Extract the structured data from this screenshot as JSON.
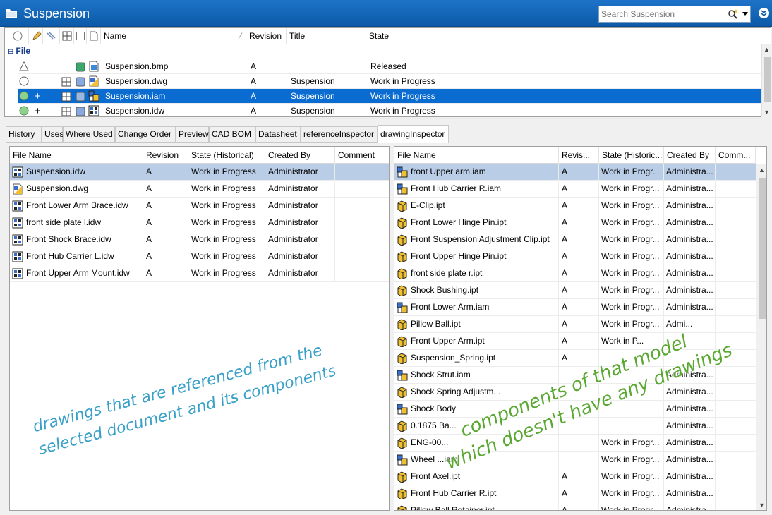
{
  "window": {
    "title": "Suspension",
    "search_placeholder": "Search Suspension"
  },
  "file_list": {
    "columns": [
      "Name",
      "Revision",
      "Title",
      "State"
    ],
    "group_label": "File",
    "rows": [
      {
        "name": "Suspension.bmp",
        "revision": "A",
        "title": "",
        "state": "Released",
        "selected": false,
        "status": "triangle",
        "type": "bmp"
      },
      {
        "name": "Suspension.dwg",
        "revision": "A",
        "title": "Suspension",
        "state": "Work in Progress",
        "selected": false,
        "status": "circle",
        "type": "dwg"
      },
      {
        "name": "Suspension.iam",
        "revision": "A",
        "title": "Suspension",
        "state": "Work in Progress",
        "selected": true,
        "status": "green",
        "type": "iam"
      },
      {
        "name": "Suspension.idw",
        "revision": "A",
        "title": "Suspension",
        "state": "Work in Progress",
        "selected": false,
        "status": "green",
        "type": "idw"
      }
    ]
  },
  "tabs": [
    "History",
    "Uses",
    "Where Used",
    "Change Order",
    "Preview",
    "CAD BOM",
    "Datasheet",
    "referenceInspector",
    "drawingInspector"
  ],
  "active_tab": "drawingInspector",
  "left_panel": {
    "columns": [
      "File Name",
      "Revision",
      "State (Historical)",
      "Created By",
      "Comment"
    ],
    "rows": [
      {
        "file": "Suspension.idw",
        "rev": "A",
        "state": "Work in Progress",
        "by": "Administrator",
        "comment": "",
        "type": "idw"
      },
      {
        "file": "Suspension.dwg",
        "rev": "A",
        "state": "Work in Progress",
        "by": "Administrator",
        "comment": "",
        "type": "dwg"
      },
      {
        "file": "Front Lower Arm Brace.idw",
        "rev": "A",
        "state": "Work in Progress",
        "by": "Administrator",
        "comment": "",
        "type": "idw"
      },
      {
        "file": "front side plate l.idw",
        "rev": "A",
        "state": "Work in Progress",
        "by": "Administrator",
        "comment": "",
        "type": "idw"
      },
      {
        "file": "Front Shock Brace.idw",
        "rev": "A",
        "state": "Work in Progress",
        "by": "Administrator",
        "comment": "",
        "type": "idw"
      },
      {
        "file": "Front Hub Carrier L.idw",
        "rev": "A",
        "state": "Work in Progress",
        "by": "Administrator",
        "comment": "",
        "type": "idw"
      },
      {
        "file": "Front Upper Arm Mount.idw",
        "rev": "A",
        "state": "Work in Progress",
        "by": "Administrator",
        "comment": "",
        "type": "idw"
      }
    ]
  },
  "right_panel": {
    "columns": [
      "File Name",
      "Revis...",
      "State (Historic...",
      "Created By",
      "Comm..."
    ],
    "rows": [
      {
        "file": "front Upper arm.iam",
        "rev": "A",
        "state": "Work in Progr...",
        "by": "Administra...",
        "type": "iam"
      },
      {
        "file": "Front Hub Carrier R.iam",
        "rev": "A",
        "state": "Work in Progr...",
        "by": "Administra...",
        "type": "iam"
      },
      {
        "file": "E-Clip.ipt",
        "rev": "A",
        "state": "Work in Progr...",
        "by": "Administra...",
        "type": "ipt"
      },
      {
        "file": "Front Lower Hinge Pin.ipt",
        "rev": "A",
        "state": "Work in Progr...",
        "by": "Administra...",
        "type": "ipt"
      },
      {
        "file": "Front Suspension Adjustment Clip.ipt",
        "rev": "A",
        "state": "Work in Progr...",
        "by": "Administra...",
        "type": "ipt"
      },
      {
        "file": "Front Upper Hinge Pin.ipt",
        "rev": "A",
        "state": "Work in Progr...",
        "by": "Administra...",
        "type": "ipt"
      },
      {
        "file": "front side plate r.ipt",
        "rev": "A",
        "state": "Work in Progr...",
        "by": "Administra...",
        "type": "ipt"
      },
      {
        "file": "Shock Bushing.ipt",
        "rev": "A",
        "state": "Work in Progr...",
        "by": "Administra...",
        "type": "ipt"
      },
      {
        "file": "Front Lower Arm.iam",
        "rev": "A",
        "state": "Work in Progr...",
        "by": "Administra...",
        "type": "iam"
      },
      {
        "file": "Pillow Ball.ipt",
        "rev": "A",
        "state": "Work in Progr...",
        "by": "Admi...",
        "type": "ipt"
      },
      {
        "file": "Front Upper Arm.ipt",
        "rev": "A",
        "state": "Work in P...",
        "by": "",
        "type": "ipt"
      },
      {
        "file": "Suspension_Spring.ipt",
        "rev": "A",
        "state": "",
        "by": "",
        "type": "ipt"
      },
      {
        "file": "Shock Strut.iam",
        "rev": "",
        "state": "",
        "by": "Administra...",
        "type": "iam"
      },
      {
        "file": "Shock Spring Adjustm...",
        "rev": "",
        "state": "",
        "by": "Administra...",
        "type": "ipt"
      },
      {
        "file": "Shock Body",
        "rev": "",
        "state": "",
        "by": "Administra...",
        "type": "iam"
      },
      {
        "file": "0.1875 Ba...",
        "rev": "",
        "state": "",
        "by": "Administra...",
        "type": "ipt"
      },
      {
        "file": "ENG-00...",
        "rev": "",
        "state": "Work in Progr...",
        "by": "Administra...",
        "type": "ipt"
      },
      {
        "file": "Wheel ...iam",
        "rev": "",
        "state": "Work in Progr...",
        "by": "Administra...",
        "type": "iam"
      },
      {
        "file": "Front Axel.ipt",
        "rev": "A",
        "state": "Work in Progr...",
        "by": "Administra...",
        "type": "ipt"
      },
      {
        "file": "Front Hub Carrier R.ipt",
        "rev": "A",
        "state": "Work in Progr...",
        "by": "Administra...",
        "type": "ipt"
      },
      {
        "file": "Pillow Ball Retainer.ipt",
        "rev": "A",
        "state": "Work in Progr...",
        "by": "Administra...",
        "type": "ipt"
      }
    ]
  },
  "annotations": {
    "left_line1": "drawings that are referenced from the",
    "left_line2": "selected document and its components",
    "right_line1": "components of that model",
    "right_line2": "which doesn't have any drawings"
  },
  "colors": {
    "title_bar": "#1565c0",
    "selection": "#0a6cd0",
    "row_highlight": "#b9cde6",
    "annotation_blue": "#3aa0c8",
    "annotation_green": "#5aa832"
  }
}
